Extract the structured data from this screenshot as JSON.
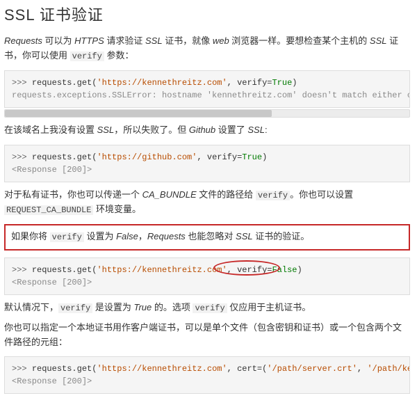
{
  "title": "SSL 证书验证",
  "p1": {
    "t1": "Requests",
    "t2": " 可以为 ",
    "t3": "HTTPS",
    "t4": " 请求验证 ",
    "t5": "SSL",
    "t6": " 证书，就像 ",
    "t7": "web",
    "t8": " 浏览器一样。要想检查某个主机的 ",
    "t9": "SSL",
    "t10": " 证书，你可以使用 ",
    "t11": "verify",
    "t12": " 参数："
  },
  "code1": {
    "prompt": ">>> ",
    "call_a": "requests.get(",
    "url": "'https://kennethreitz.com'",
    "call_b": ", verify=",
    "bool": "True",
    "call_c": ")",
    "err": "requests.exceptions.SSLError: hostname 'kennethreitz.com' doesn't match either of '*."
  },
  "p2": {
    "t1": "在该域名上我没有设置 ",
    "t2": "SSL",
    "t3": "，所以失败了。但 ",
    "t4": "Github",
    "t5": " 设置了 ",
    "t6": "SSL",
    "t7": ":"
  },
  "code2": {
    "prompt": ">>> ",
    "call_a": "requests.get(",
    "url": "'https://github.com'",
    "call_b": ", verify=",
    "bool": "True",
    "call_c": ")",
    "resp": "<Response [200]>"
  },
  "p3": {
    "t1": "对于私有证书，你也可以传递一个 ",
    "t2": "CA_BUNDLE",
    "t3": " 文件的路径给 ",
    "t4": "verify",
    "t5": "。你也可以设置 ",
    "t6": "REQUEST_CA_BUNDLE",
    "t7": " 环境变量。"
  },
  "p4": {
    "t1": "如果你将 ",
    "t2": "verify",
    "t3": " 设置为 ",
    "t4": "False",
    "t5": "，",
    "t6": "Requests",
    "t7": " 也能忽略对 ",
    "t8": "SSL",
    "t9": " 证书的验证。"
  },
  "code3": {
    "prompt": ">>> ",
    "call_a": "requests.get(",
    "url": "'https://kennethreitz.com'",
    "call_b": ", verify=",
    "bool": "False",
    "call_c": ")",
    "resp": "<Response [200]>"
  },
  "p5": {
    "t1": "默认情况下，",
    "t2": "verify",
    "t3": " 是设置为 ",
    "t4": "True",
    "t5": " 的。选项 ",
    "t6": "verify",
    "t7": " 仅应用于主机证书。"
  },
  "p6": {
    "t1": "你也可以指定一个本地证书用作客户端证书，可以是单个文件（包含密钥和证书）或一个包含两个文件路径的元组："
  },
  "code4": {
    "prompt": ">>> ",
    "call_a": "requests.get(",
    "url": "'https://kennethreitz.com'",
    "call_b": ", cert=(",
    "path1": "'/path/server.crt'",
    "call_c": ", ",
    "path2": "'/path/key'",
    "call_d": "))",
    "resp": "<Response [200]>"
  }
}
